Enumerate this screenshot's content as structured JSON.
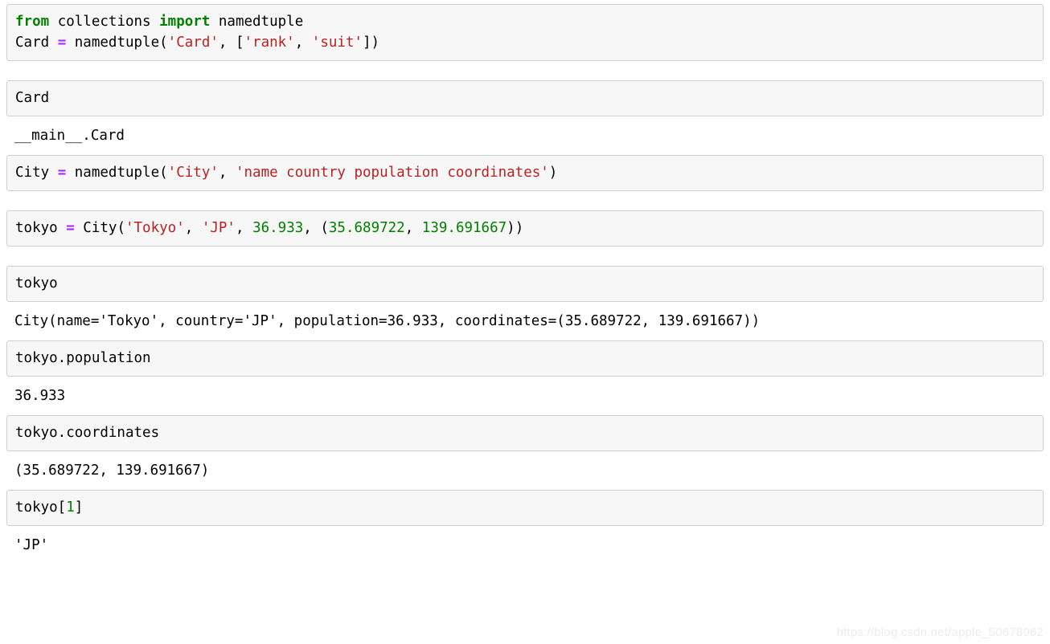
{
  "document": {
    "kind": "jupyter-notebook-screenshot",
    "background_color": "#ffffff",
    "cell_background_color": "#f7f7f7",
    "cell_border_color": "#cfcfcf"
  },
  "theme": {
    "keyword_color": "#008000",
    "string_color": "#ba2121",
    "number_color": "#008000",
    "operator_color": "#aa22ff",
    "text_color": "#000000",
    "watermark_color": "#ececec"
  },
  "cells": [
    {
      "id": "cell-1",
      "type": "code",
      "lines": [
        [
          {
            "t": "from",
            "c": "k"
          },
          {
            "t": " collections ",
            "c": "n"
          },
          {
            "t": "import",
            "c": "k"
          },
          {
            "t": " namedtuple",
            "c": "n"
          }
        ],
        [
          {
            "t": "Card ",
            "c": "n"
          },
          {
            "t": "=",
            "c": "o"
          },
          {
            "t": " namedtuple(",
            "c": "n"
          },
          {
            "t": "'Card'",
            "c": "s"
          },
          {
            "t": ", [",
            "c": "p"
          },
          {
            "t": "'rank'",
            "c": "s"
          },
          {
            "t": ", ",
            "c": "p"
          },
          {
            "t": "'suit'",
            "c": "s"
          },
          {
            "t": "])",
            "c": "p"
          }
        ]
      ],
      "output": null
    },
    {
      "id": "cell-2",
      "type": "code",
      "lines": [
        [
          {
            "t": "Card",
            "c": "n"
          }
        ]
      ],
      "output": {
        "lines": [
          "__main__.Card"
        ]
      }
    },
    {
      "id": "cell-3",
      "type": "code",
      "lines": [
        [
          {
            "t": "City ",
            "c": "n"
          },
          {
            "t": "=",
            "c": "o"
          },
          {
            "t": " namedtuple(",
            "c": "n"
          },
          {
            "t": "'City'",
            "c": "s"
          },
          {
            "t": ", ",
            "c": "p"
          },
          {
            "t": "'name country population coordinates'",
            "c": "s"
          },
          {
            "t": ")",
            "c": "p"
          }
        ]
      ],
      "output": null
    },
    {
      "id": "cell-4",
      "type": "code",
      "lines": [
        [
          {
            "t": "tokyo ",
            "c": "n"
          },
          {
            "t": "=",
            "c": "o"
          },
          {
            "t": " City(",
            "c": "n"
          },
          {
            "t": "'Tokyo'",
            "c": "s"
          },
          {
            "t": ", ",
            "c": "p"
          },
          {
            "t": "'JP'",
            "c": "s"
          },
          {
            "t": ", ",
            "c": "p"
          },
          {
            "t": "36.933",
            "c": "m"
          },
          {
            "t": ", (",
            "c": "p"
          },
          {
            "t": "35.689722",
            "c": "m"
          },
          {
            "t": ", ",
            "c": "p"
          },
          {
            "t": "139.691667",
            "c": "m"
          },
          {
            "t": "))",
            "c": "p"
          }
        ]
      ],
      "output": null
    },
    {
      "id": "cell-5",
      "type": "code",
      "lines": [
        [
          {
            "t": "tokyo",
            "c": "n"
          }
        ]
      ],
      "output": {
        "lines": [
          "City(name='Tokyo', country='JP', population=36.933, coordinates=(35.689722, 139.691667))"
        ]
      }
    },
    {
      "id": "cell-6",
      "type": "code",
      "lines": [
        [
          {
            "t": "tokyo.population",
            "c": "n"
          }
        ]
      ],
      "output": {
        "lines": [
          "36.933"
        ]
      }
    },
    {
      "id": "cell-7",
      "type": "code",
      "lines": [
        [
          {
            "t": "tokyo.coordinates",
            "c": "n"
          }
        ]
      ],
      "output": {
        "lines": [
          "(35.689722, 139.691667)"
        ]
      }
    },
    {
      "id": "cell-8",
      "type": "code",
      "lines": [
        [
          {
            "t": "tokyo[",
            "c": "n"
          },
          {
            "t": "1",
            "c": "m"
          },
          {
            "t": "]",
            "c": "p"
          }
        ]
      ],
      "output": {
        "lines": [
          "'JP'"
        ]
      }
    }
  ],
  "watermark": {
    "text": "https://blog.csdn.net/apple_50678962"
  }
}
